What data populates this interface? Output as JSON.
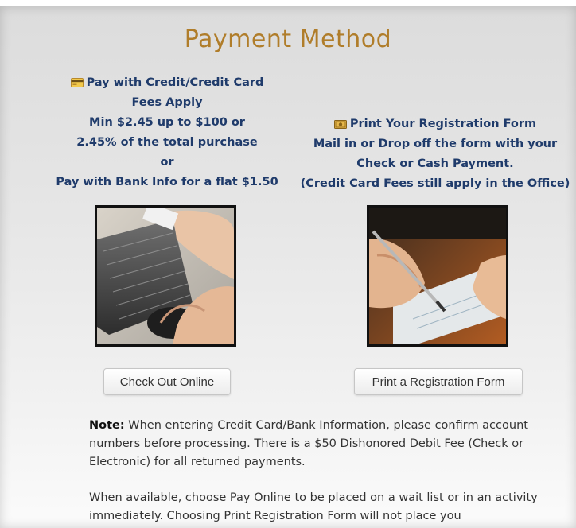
{
  "page": {
    "title": "Payment Method"
  },
  "left_column": {
    "lines": [
      "Pay with Credit/Credit Card",
      "Fees Apply",
      "Min $2.45 up to $100 or",
      "2.45% of the total purchase",
      "or",
      "Pay with Bank Info for a flat $1.50"
    ],
    "icon": "credit-card-icon",
    "button_label": "Check Out Online"
  },
  "right_column": {
    "lines": [
      "Print Your Registration Form",
      "Mail in or Drop off the form with your",
      "Check or Cash Payment.",
      "(Credit Card Fees still apply in the Office)"
    ],
    "icon": "cash-icon",
    "button_label": "Print a Registration Form"
  },
  "note": {
    "label": "Note:",
    "text": " When entering Credit Card/Bank Information, please confirm account numbers before processing.  There is a $50 Dishonored Debit Fee (Check or Electronic) for all returned payments.",
    "paragraph2": "When available, choose Pay Online to be placed on a wait list or in an activity immediately. Choosing Print Registration Form will not place you"
  },
  "colors": {
    "title": "#b07d2a",
    "column_text": "#1f3b6b",
    "body_text": "#333333"
  }
}
